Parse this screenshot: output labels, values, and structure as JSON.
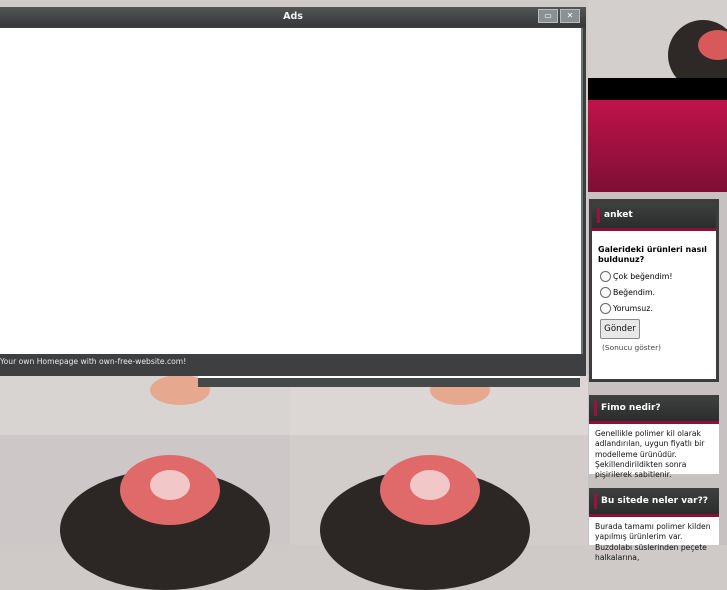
{
  "ads": {
    "title": "Ads",
    "footer": "Your own Homepage with own-free-website.com!",
    "controls": {
      "minimize": "▭",
      "close": "✕"
    }
  },
  "poll": {
    "header": "anket",
    "question": "Galerideki ürünleri nasıl buldunuz?",
    "options": [
      "Çok beğendim!",
      "Beğendim.",
      "Yorumsuz."
    ],
    "submit": "Gönder",
    "results": "(Sonucu göster)"
  },
  "fimo": {
    "header": "Fimo nedir?",
    "text": "Genellikle polimer kil olarak adlandırılan, uygun fiyatlı bir modelleme ürünüdür. Şekillendirildikten sonra pişirilerek sabitlenir."
  },
  "site": {
    "header": "Bu sitede neler var??",
    "text": "Burada tamamı polimer kilden yapılmış ürünlerim var. Buzdolabı süslerinden peçete halkalarına,"
  },
  "colors": {
    "accent": "#a0103f",
    "header_dark": "#2b2d2c"
  }
}
